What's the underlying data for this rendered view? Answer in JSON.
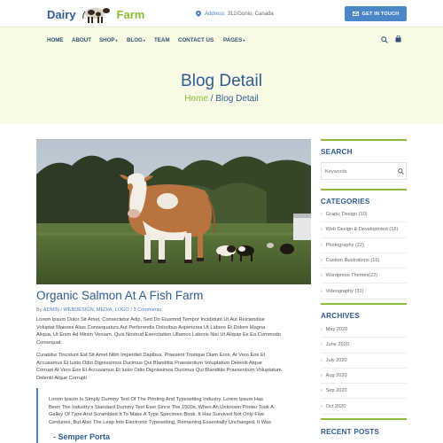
{
  "header": {
    "logo_left": "Dairy",
    "logo_right": "Farm",
    "address_label": "Address:",
    "address_value": "312/Gonio, Canada",
    "cta_label": "GET IN TOUCH"
  },
  "nav": {
    "items": [
      {
        "label": "HOME",
        "caret": ""
      },
      {
        "label": "ABOUT",
        "caret": ""
      },
      {
        "label": "SHOP",
        "caret": "▾"
      },
      {
        "label": "BLOG",
        "caret": "▾"
      },
      {
        "label": "TEAM",
        "caret": ""
      },
      {
        "label": "CONTACT US",
        "caret": ""
      },
      {
        "label": "PAGES",
        "caret": "▾"
      }
    ],
    "icons": [
      "search-icon",
      "shopping-bag-icon"
    ]
  },
  "hero": {
    "title": "Blog Detail",
    "crumb_home": "Home",
    "crumb_sep": " / ",
    "crumb_current": "Blog Detail"
  },
  "post": {
    "title": "Organic Salmon At A Fish Farm",
    "meta_by": "By ",
    "meta_author": "ADMIN",
    "meta_sep1": " / ",
    "meta_cats": "WEBDESIGN, MEDIA, LOGO",
    "meta_sep2": " / ",
    "meta_comments": "3 Comments",
    "para1": [
      "Lorem Ipsum Dolor Sit Amet, Consectetur Adip, Sed Do Eiusmod Tempor Incididunt Ut Aut Reiciendise",
      "Voluptat Maiores Alias Consequaturs Aut Perferendis Doloribus Asperiores Ut Labore Et Dolore Magna",
      "Aliqua, Ut Enim Ad Minim Veniam, Quis Nostrud Exercitation Ullamco Laboris Nisi Ut Aliquip Ex Ea Commodo",
      "Consequat."
    ],
    "para2": [
      "Curabitur Tincidunt Est Sit Amet Nibh Imperdiet Dapibus. Praesent Tristique Diam Eros, At Vero Eos Et",
      "Accusamus Et Iusto Odio Dignissimos Ducimus Qui Blanditiis Praesentium Voluptatum Deleniti Atque",
      "Corrupt At Vero Eos Et Accusamus Et Iusto Odio Dignissimos Ducimus Qui Blanditiis Praesentium Voluptatum",
      "Deleniti Atque Corrupti"
    ],
    "quote": [
      "Lorem Ipsum Is Simply Dummy Text Of The Printing And Typesetting Industry. Lorem Ipsum Has",
      "Been The Industry's Standard Dummy Text Ever Since The 1500s, When An Unknown Printer Took A",
      "Galley Of Type And Scrambled It To Make A Type Specimen Book. It Has Survived Not Only Five",
      "Centuries, But Also The Leap Into Electronic Typesetting, Remaining Essentially Unchanged. It Was"
    ],
    "quote_author": "- Semper Porta"
  },
  "sidebar": {
    "search_title": "SEARCH",
    "search_placeholder": "Keywords",
    "categories_title": "CATEGORIES",
    "categories": [
      "Grapic Design (10)",
      "Web Design & Development (15)",
      "Photography (22)",
      "Custom Illustrations (16)",
      "Wordpress Themes(22)",
      "Videography (31)"
    ],
    "archives_title": "ARCHIVES",
    "archives": [
      "May 2020",
      "June 2020",
      "July 2020",
      "Aug 2020",
      "Sep 2020",
      "Oct 2020"
    ],
    "recent_title": "RECENT POSTS"
  },
  "colors": {
    "brand_blue": "#2f5d94",
    "accent_green": "#8dbb3a",
    "button_blue": "#4a86c8",
    "nav_bg": "#f8fbe4"
  }
}
